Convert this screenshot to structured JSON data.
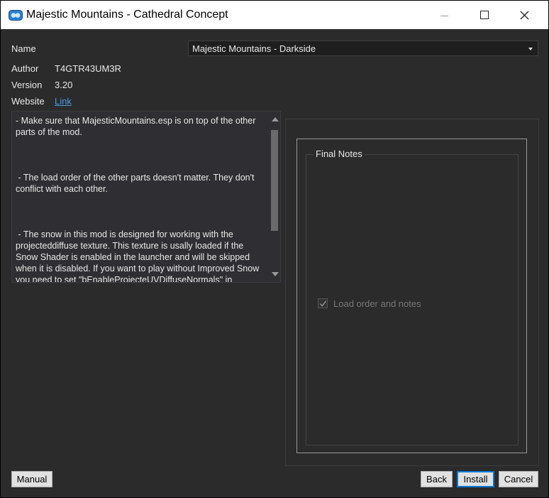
{
  "window": {
    "title": "Majestic Mountains - Cathedral Concept"
  },
  "info": {
    "name_label": "Name",
    "author_label": "Author",
    "author_value": "T4GTR43UM3R",
    "version_label": "Version",
    "version_value": "3.20",
    "website_label": "Website",
    "website_link": "Link"
  },
  "option_select": {
    "selected": "Majestic Mountains - Darkside"
  },
  "notes_text": "- Make sure that MajesticMountains.esp is on top of the other parts of the mod.\n\n\n\n - The load order of the other parts doesn't matter. They don't conflict with each other.\n\n\n\n - The snow in this mod is designed for working with the projecteddiffuse texture. This texture is usally loaded if the Snow Shader is enabled in the launcher and will be skipped when it is disabled. If you want to play without Improved Snow you need to set \"bEnableProjecteUVDiffuseNormals\" in",
  "group": {
    "title": "Final Notes",
    "checkbox_label": "Load order and notes",
    "checkbox_checked": true
  },
  "buttons": {
    "manual": "Manual",
    "back": "Back",
    "install": "Install",
    "cancel": "Cancel"
  },
  "colors": {
    "background": "#2b2b2b",
    "link": "#4a9aea",
    "primary_border": "#0078d7"
  }
}
